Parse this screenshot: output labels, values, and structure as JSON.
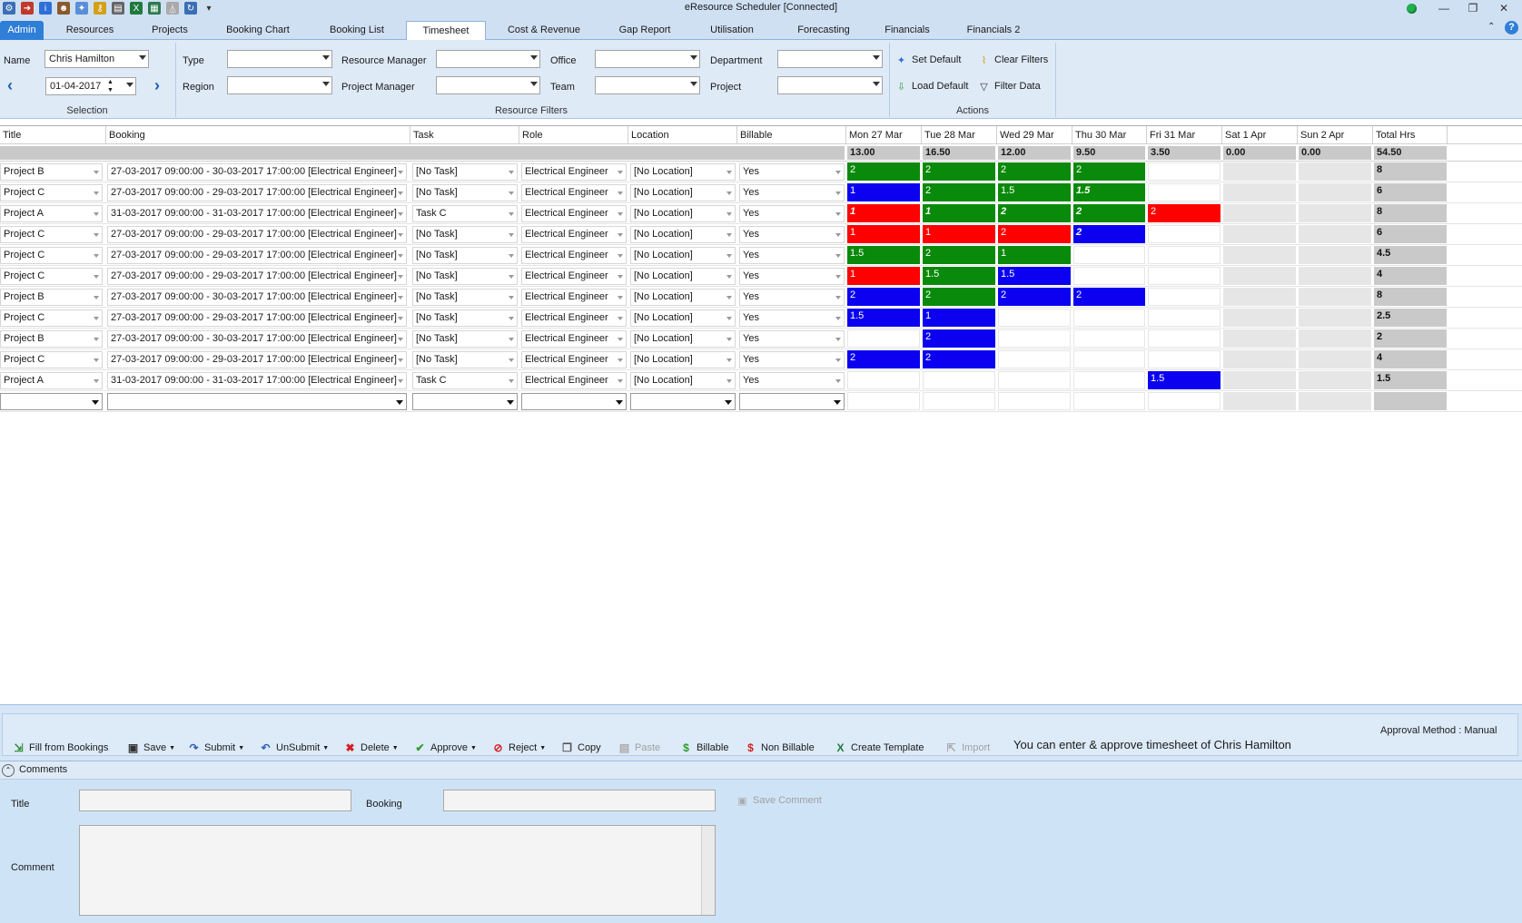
{
  "window": {
    "title": "eResource Scheduler [Connected]",
    "controls": [
      "minimize",
      "restore",
      "close"
    ]
  },
  "quick_access": {
    "icons": [
      "plugin-icon",
      "logout-icon",
      "info-icon",
      "user-icon",
      "pin-icon",
      "key-icon",
      "print-icon",
      "excel-icon",
      "chart-export-icon",
      "filter-icon",
      "refresh-icon",
      "dropdown-icon"
    ]
  },
  "tabs": [
    "Admin",
    "Resources",
    "Projects",
    "Booking Chart",
    "Booking List",
    "Timesheet",
    "Cost & Revenue",
    "Gap Report",
    "Utilisation",
    "Forecasting",
    "Financials",
    "Financials 2"
  ],
  "active_tab": "Timesheet",
  "selection": {
    "name_label": "Name",
    "name_value": "Chris Hamilton",
    "date_value": "01-04-2017",
    "group_label": "Selection"
  },
  "filters": {
    "type_label": "Type",
    "region_label": "Region",
    "resource_manager_label": "Resource Manager",
    "project_manager_label": "Project Manager",
    "office_label": "Office",
    "team_label": "Team",
    "department_label": "Department",
    "project_label": "Project",
    "group_label": "Resource Filters"
  },
  "actions": {
    "set_default": "Set Default",
    "clear_filters": "Clear Filters",
    "load_default": "Load Default",
    "filter_data": "Filter Data",
    "group_label": "Actions"
  },
  "grid": {
    "columns": [
      "Title",
      "Booking",
      "Task",
      "Role",
      "Location",
      "Billable"
    ],
    "days": [
      "Mon 27 Mar",
      "Tue 28 Mar",
      "Wed 29 Mar",
      "Thu 30 Mar",
      "Fri 31 Mar",
      "Sat 1 Apr",
      "Sun 2 Apr"
    ],
    "total_header": "Total Hrs",
    "day_totals": [
      "13.00",
      "16.50",
      "12.00",
      "9.50",
      "3.50",
      "0.00",
      "0.00"
    ],
    "grand_total": "54.50",
    "rows": [
      {
        "title": "Project B",
        "booking": "27-03-2017 09:00:00 - 30-03-2017 17:00:00 [Electrical Engineer]",
        "task": "[No Task]",
        "role": "Electrical Engineer",
        "location": "[No Location]",
        "billable": "Yes",
        "hours": [
          {
            "v": "2",
            "c": "green"
          },
          {
            "v": "2",
            "c": "green"
          },
          {
            "v": "2",
            "c": "green"
          },
          {
            "v": "2",
            "c": "green"
          },
          {
            "v": "",
            "c": "empty"
          },
          {
            "v": "",
            "c": "weekend"
          },
          {
            "v": "",
            "c": "weekend"
          }
        ],
        "total": "8"
      },
      {
        "title": "Project C",
        "booking": "27-03-2017 09:00:00 - 29-03-2017 17:00:00 [Electrical Engineer]",
        "task": "[No Task]",
        "role": "Electrical Engineer",
        "location": "[No Location]",
        "billable": "Yes",
        "hours": [
          {
            "v": "1",
            "c": "blue"
          },
          {
            "v": "2",
            "c": "green"
          },
          {
            "v": "1.5",
            "c": "green"
          },
          {
            "v": "1.5",
            "c": "green",
            "i": true
          },
          {
            "v": "",
            "c": "empty"
          },
          {
            "v": "",
            "c": "weekend"
          },
          {
            "v": "",
            "c": "weekend"
          }
        ],
        "total": "6"
      },
      {
        "title": "Project A",
        "booking": "31-03-2017 09:00:00 - 31-03-2017 17:00:00 [Electrical Engineer]",
        "task": "Task C",
        "role": "Electrical Engineer",
        "location": "[No Location]",
        "billable": "Yes",
        "hours": [
          {
            "v": "1",
            "c": "red",
            "i": true
          },
          {
            "v": "1",
            "c": "green",
            "i": true
          },
          {
            "v": "2",
            "c": "green",
            "i": true
          },
          {
            "v": "2",
            "c": "green",
            "i": true
          },
          {
            "v": "2",
            "c": "red"
          },
          {
            "v": "",
            "c": "weekend"
          },
          {
            "v": "",
            "c": "weekend"
          }
        ],
        "total": "8"
      },
      {
        "title": "Project C",
        "booking": "27-03-2017 09:00:00 - 29-03-2017 17:00:00 [Electrical Engineer]",
        "task": "[No Task]",
        "role": "Electrical Engineer",
        "location": "[No Location]",
        "billable": "Yes",
        "hours": [
          {
            "v": "1",
            "c": "red"
          },
          {
            "v": "1",
            "c": "red"
          },
          {
            "v": "2",
            "c": "red"
          },
          {
            "v": "2",
            "c": "blue",
            "i": true
          },
          {
            "v": "",
            "c": "empty"
          },
          {
            "v": "",
            "c": "weekend"
          },
          {
            "v": "",
            "c": "weekend"
          }
        ],
        "total": "6"
      },
      {
        "title": "Project C",
        "booking": "27-03-2017 09:00:00 - 29-03-2017 17:00:00 [Electrical Engineer]",
        "task": "[No Task]",
        "role": "Electrical Engineer",
        "location": "[No Location]",
        "billable": "Yes",
        "hours": [
          {
            "v": "1.5",
            "c": "green"
          },
          {
            "v": "2",
            "c": "green"
          },
          {
            "v": "1",
            "c": "green"
          },
          {
            "v": "",
            "c": "empty"
          },
          {
            "v": "",
            "c": "empty"
          },
          {
            "v": "",
            "c": "weekend"
          },
          {
            "v": "",
            "c": "weekend"
          }
        ],
        "total": "4.5"
      },
      {
        "title": "Project C",
        "booking": "27-03-2017 09:00:00 - 29-03-2017 17:00:00 [Electrical Engineer]",
        "task": "[No Task]",
        "role": "Electrical Engineer",
        "location": "[No Location]",
        "billable": "Yes",
        "hours": [
          {
            "v": "1",
            "c": "red"
          },
          {
            "v": "1.5",
            "c": "green"
          },
          {
            "v": "1.5",
            "c": "blue"
          },
          {
            "v": "",
            "c": "empty"
          },
          {
            "v": "",
            "c": "empty"
          },
          {
            "v": "",
            "c": "weekend"
          },
          {
            "v": "",
            "c": "weekend"
          }
        ],
        "total": "4"
      },
      {
        "title": "Project B",
        "booking": "27-03-2017 09:00:00 - 30-03-2017 17:00:00 [Electrical Engineer]",
        "task": "[No Task]",
        "role": "Electrical Engineer",
        "location": "[No Location]",
        "billable": "Yes",
        "hours": [
          {
            "v": "2",
            "c": "blue"
          },
          {
            "v": "2",
            "c": "green"
          },
          {
            "v": "2",
            "c": "blue"
          },
          {
            "v": "2",
            "c": "blue"
          },
          {
            "v": "",
            "c": "empty"
          },
          {
            "v": "",
            "c": "weekend"
          },
          {
            "v": "",
            "c": "weekend"
          }
        ],
        "total": "8"
      },
      {
        "title": "Project C",
        "booking": "27-03-2017 09:00:00 - 29-03-2017 17:00:00 [Electrical Engineer]",
        "task": "[No Task]",
        "role": "Electrical Engineer",
        "location": "[No Location]",
        "billable": "Yes",
        "hours": [
          {
            "v": "1.5",
            "c": "blue"
          },
          {
            "v": "1",
            "c": "blue"
          },
          {
            "v": "",
            "c": "empty"
          },
          {
            "v": "",
            "c": "empty"
          },
          {
            "v": "",
            "c": "empty"
          },
          {
            "v": "",
            "c": "weekend"
          },
          {
            "v": "",
            "c": "weekend"
          }
        ],
        "total": "2.5"
      },
      {
        "title": "Project B",
        "booking": "27-03-2017 09:00:00 - 30-03-2017 17:00:00 [Electrical Engineer]",
        "task": "[No Task]",
        "role": "Electrical Engineer",
        "location": "[No Location]",
        "billable": "Yes",
        "hours": [
          {
            "v": "",
            "c": "empty"
          },
          {
            "v": "2",
            "c": "blue"
          },
          {
            "v": "",
            "c": "empty"
          },
          {
            "v": "",
            "c": "empty"
          },
          {
            "v": "",
            "c": "empty"
          },
          {
            "v": "",
            "c": "weekend"
          },
          {
            "v": "",
            "c": "weekend"
          }
        ],
        "total": "2"
      },
      {
        "title": "Project C",
        "booking": "27-03-2017 09:00:00 - 29-03-2017 17:00:00 [Electrical Engineer]",
        "task": "[No Task]",
        "role": "Electrical Engineer",
        "location": "[No Location]",
        "billable": "Yes",
        "hours": [
          {
            "v": "2",
            "c": "blue"
          },
          {
            "v": "2",
            "c": "blue"
          },
          {
            "v": "",
            "c": "empty"
          },
          {
            "v": "",
            "c": "empty"
          },
          {
            "v": "",
            "c": "empty"
          },
          {
            "v": "",
            "c": "weekend"
          },
          {
            "v": "",
            "c": "weekend"
          }
        ],
        "total": "4"
      },
      {
        "title": "Project A",
        "booking": "31-03-2017 09:00:00 - 31-03-2017 17:00:00 [Electrical Engineer]",
        "task": "Task C",
        "role": "Electrical Engineer",
        "location": "[No Location]",
        "billable": "Yes",
        "hours": [
          {
            "v": "",
            "c": "empty"
          },
          {
            "v": "",
            "c": "empty"
          },
          {
            "v": "",
            "c": "empty"
          },
          {
            "v": "",
            "c": "empty"
          },
          {
            "v": "1.5",
            "c": "blue"
          },
          {
            "v": "",
            "c": "weekend"
          },
          {
            "v": "",
            "c": "weekend"
          }
        ],
        "total": "1.5"
      }
    ]
  },
  "colors": {
    "green": "#0a8a0a",
    "blue": "#0b00f0",
    "red": "#ff0000",
    "accent": "#2f7ed8"
  },
  "toolbar": {
    "approval_method": "Approval Method : Manual",
    "fill_from_bookings": "Fill from Bookings",
    "save": "Save",
    "submit": "Submit",
    "unsubmit": "UnSubmit",
    "delete": "Delete",
    "approve": "Approve",
    "reject": "Reject",
    "copy": "Copy",
    "paste": "Paste",
    "billable": "Billable",
    "non_billable": "Non Billable",
    "create_template": "Create Template",
    "import": "Import",
    "message": "You can enter & approve timesheet of Chris Hamilton"
  },
  "comments": {
    "header": "Comments",
    "title_label": "Title",
    "booking_label": "Booking",
    "comment_label": "Comment",
    "save_comment": "Save Comment"
  }
}
